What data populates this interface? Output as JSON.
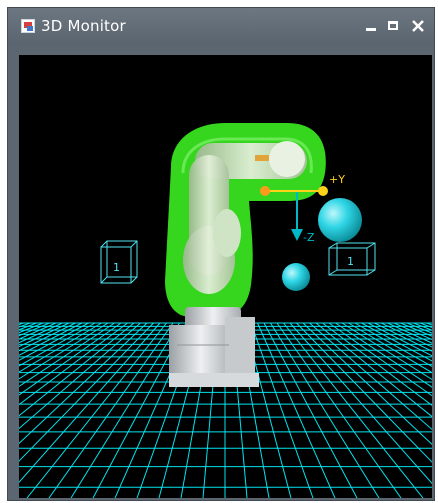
{
  "window": {
    "title": "3D Monitor",
    "icon": "monitor-app-icon",
    "controls": {
      "minimize": "minimize-icon",
      "maximize": "maximize-icon",
      "close": "close-icon"
    }
  },
  "scene": {
    "background_color": "#000000",
    "floor_grid_color": "#00e5f0",
    "wireframe_color": "#4fe3f0",
    "sphere_color": "#2fd6e6",
    "robot_body_color": "#d9dde0",
    "interference_zone_color": "#39e81f",
    "axes": {
      "y_label": "+Y",
      "z_label": "-Z",
      "y_color": "#ffd21a",
      "z_color": "#00b8c8"
    },
    "tool_label": "",
    "left_box_label": "1",
    "right_box_label": "1"
  }
}
